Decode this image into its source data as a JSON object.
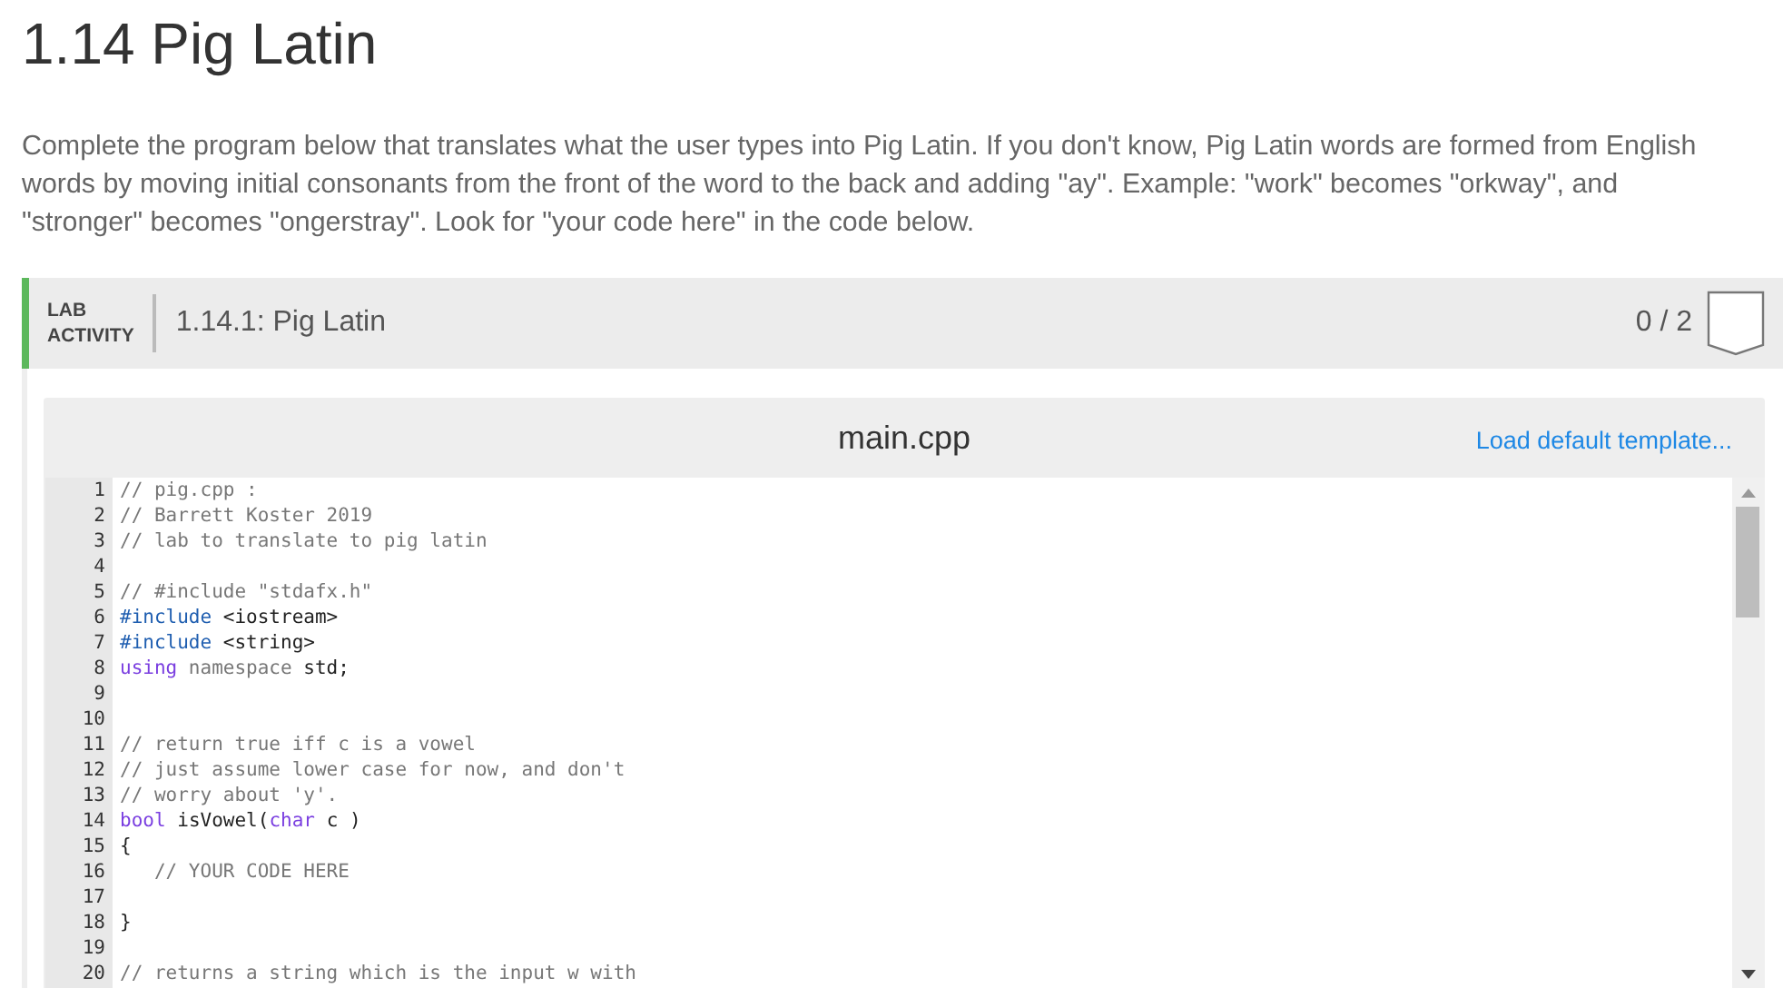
{
  "title": "1.14 Pig Latin",
  "intro": "Complete the program below that translates what the user types into Pig Latin. If you don't know, Pig Latin words are formed from English words by moving initial consonants from the front of the word to the back and adding \"ay\". Example: \"work\" becomes \"orkway\", and \"stronger\" becomes \"ongerstray\". Look for \"your code here\" in the code below.",
  "lab": {
    "tag_top": "LAB",
    "tag_bottom": "ACTIVITY",
    "name": "1.14.1: Pig Latin",
    "score": "0 / 2"
  },
  "editor": {
    "file": "main.cpp",
    "template_link": "Load default template...",
    "lines": [
      {
        "number": "1",
        "tokens": [
          {
            "kind": "comment",
            "text": "// pig.cpp :"
          }
        ]
      },
      {
        "number": "2",
        "tokens": [
          {
            "kind": "comment",
            "text": "// Barrett Koster 2019"
          }
        ]
      },
      {
        "number": "3",
        "tokens": [
          {
            "kind": "comment",
            "text": "// lab to translate to pig latin"
          }
        ]
      },
      {
        "number": "4"
      },
      {
        "number": "5",
        "tokens": [
          {
            "kind": "comment",
            "text": "// #include \"stdafx.h\""
          }
        ]
      },
      {
        "number": "6",
        "tokens": [
          {
            "kind": "directive",
            "text": "#include"
          },
          {
            "kind": "plain",
            "text": " <iostream>"
          }
        ]
      },
      {
        "number": "7",
        "tokens": [
          {
            "kind": "directive",
            "text": "#include"
          },
          {
            "kind": "plain",
            "text": " <string>"
          }
        ]
      },
      {
        "number": "8",
        "tokens": [
          {
            "kind": "keyword",
            "text": "using"
          },
          {
            "kind": "comment",
            "text": " namespace"
          },
          {
            "kind": "plain",
            "text": " std;"
          }
        ]
      },
      {
        "number": "9"
      },
      {
        "number": "10"
      },
      {
        "number": "11",
        "tokens": [
          {
            "kind": "comment",
            "text": "// return true iff c is a vowel"
          }
        ]
      },
      {
        "number": "12",
        "tokens": [
          {
            "kind": "comment",
            "text": "// just assume lower case for now, and don't"
          }
        ]
      },
      {
        "number": "13",
        "tokens": [
          {
            "kind": "comment",
            "text": "// worry about 'y'."
          }
        ]
      },
      {
        "number": "14",
        "tokens": [
          {
            "kind": "keyword",
            "text": "bool"
          },
          {
            "kind": "plain",
            "text": " isVowel("
          },
          {
            "kind": "keyword",
            "text": "char"
          },
          {
            "kind": "plain",
            "text": " c )"
          }
        ]
      },
      {
        "number": "15",
        "tokens": [
          {
            "kind": "plain",
            "text": "{"
          }
        ]
      },
      {
        "number": "16",
        "tokens": [
          {
            "kind": "comment",
            "text": "   // YOUR CODE HERE"
          }
        ]
      },
      {
        "number": "17"
      },
      {
        "number": "18",
        "tokens": [
          {
            "kind": "plain",
            "text": "}"
          }
        ]
      },
      {
        "number": "19"
      },
      {
        "number": "20",
        "tokens": [
          {
            "kind": "comment",
            "text": "// returns a string which is the input w with"
          }
        ]
      }
    ]
  }
}
